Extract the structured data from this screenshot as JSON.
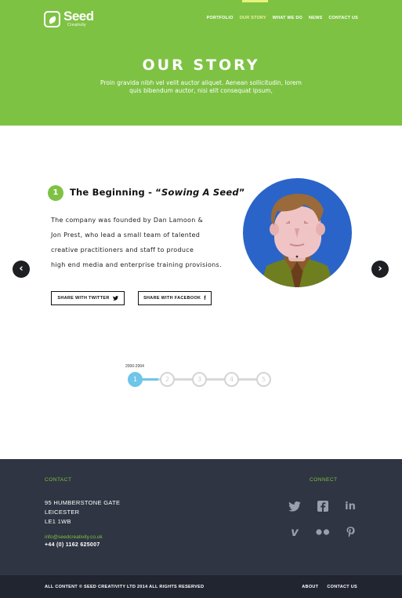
{
  "brand": {
    "name": "Seed",
    "tagline": "Creativity",
    "accent": "#7ec244"
  },
  "nav": {
    "items": [
      {
        "label": "PORTFOLIO",
        "active": false
      },
      {
        "label": "OUR STORY",
        "active": true
      },
      {
        "label": "WHAT WE DO",
        "active": false
      },
      {
        "label": "NEWS",
        "active": false
      },
      {
        "label": "CONTACT US",
        "active": false
      }
    ]
  },
  "hero": {
    "title": "OUR STORY",
    "subtitle": "Proin gravida nibh vel velit auctor aliquet. Aenean sollicitudin, lorem quis bibendum auctor, nisi elit consequat ipsum,"
  },
  "story": {
    "step": "1",
    "title_prefix": "The Beginning - “",
    "title_emphasis": "Sowing A Seed",
    "title_suffix": "”",
    "lines": [
      "The company was founded by Dan Lamoon &",
      "Jon Prest, who lead a small team of talented",
      "creative practitioners and staff to produce",
      "high end media and enterprise training provisions."
    ],
    "share_twitter": "SHARE WITH TWITTER",
    "share_facebook": "SHARE WITH FACEBOOK",
    "prev_icon": "chevron-left-icon",
    "next_icon": "chevron-right-icon"
  },
  "timeline": {
    "range_label": "2000-2004",
    "nodes": [
      "1",
      "2",
      "3",
      "4",
      "5"
    ],
    "active_index": 0,
    "progress_color": "#6ec6e8"
  },
  "footer": {
    "contact_heading": "CONTACT",
    "connect_heading": "CONNECT",
    "address": [
      "95 HUMBERSTONE GATE",
      "LEICESTER",
      "LE1 1WB"
    ],
    "email": "info@seedcreativity.co.uk",
    "phone": "+44 (0) 1162 625007",
    "social_icons": [
      "twitter-icon",
      "facebook-icon",
      "linkedin-icon",
      "vimeo-icon",
      "flickr-icon",
      "pinterest-icon"
    ],
    "copyright": "ALL CONTENT © SEED CREATIVITY LTD 2014 ALL RIGHTS RESERVED",
    "links": [
      "ABOUT",
      "CONTACT US"
    ]
  }
}
